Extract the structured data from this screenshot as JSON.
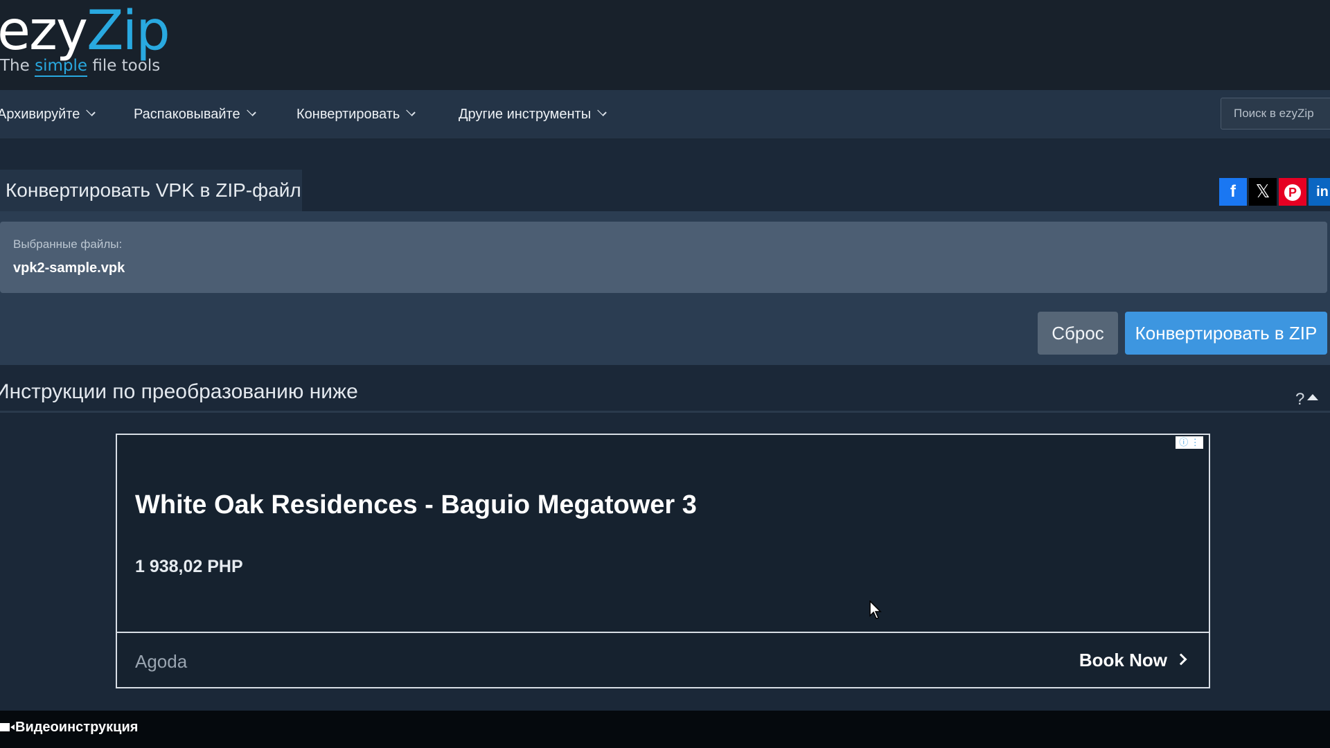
{
  "logo": {
    "ezy": "ezy",
    "zip": "Zip",
    "tag_the": "The",
    "tag_simple": "simple",
    "tag_rest": "file tools"
  },
  "nav": {
    "items": [
      {
        "label": "Архивируйте"
      },
      {
        "label": "Распаковывайте"
      },
      {
        "label": "Конвертировать"
      },
      {
        "label": "Другие инструменты"
      }
    ],
    "search_placeholder": "Поиск в ezyZip"
  },
  "page_title": "Конвертировать VPK в ZIP-файл",
  "social": {
    "facebook": "f",
    "x": "𝕏",
    "pinterest": "P",
    "linkedin": "in"
  },
  "files": {
    "label": "Выбранные файлы:",
    "name": "vpk2-sample.vpk"
  },
  "buttons": {
    "reset": "Сброс",
    "convert": "Конвертировать в ZIP"
  },
  "instructions": {
    "text": "Инструкции по преобразованию ниже",
    "icon_text": "?"
  },
  "ad": {
    "title": "White Oak Residences - Baguio Megatower 3",
    "price": "1 938,02 PHP",
    "brand": "Agoda",
    "cta": "Book Now",
    "choices": "ⓘ ⋮"
  },
  "footer": {
    "video_label": "Видеоинструкция"
  },
  "colors": {
    "accent": "#29a9e0",
    "convert_button": "#3d96e0",
    "background": "#1b2838"
  }
}
